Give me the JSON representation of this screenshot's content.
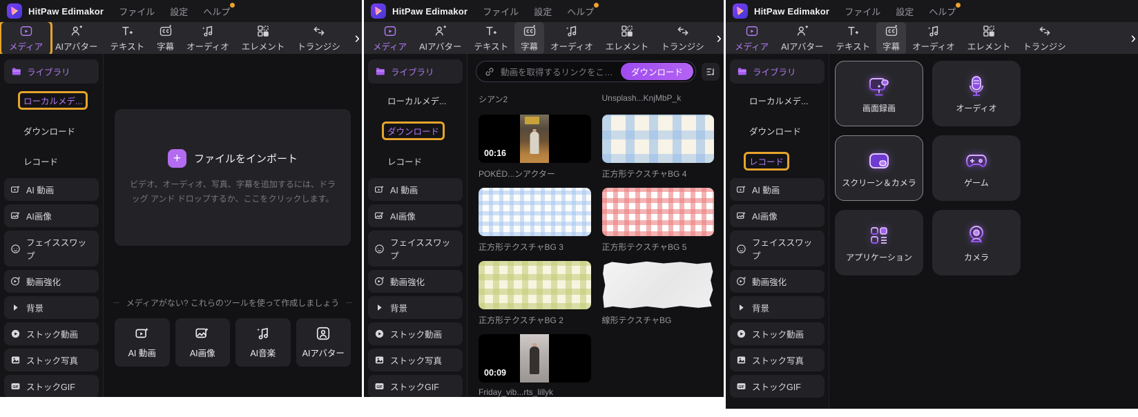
{
  "colors": {
    "accent": "#a95ef2",
    "tab_active": "#b279f2",
    "highlight_box": "#e7a52b",
    "download_button_bg": "#a855f0"
  },
  "app": {
    "title": "HitPaw Edimakor",
    "menu": [
      {
        "label": "ファイル"
      },
      {
        "label": "設定"
      },
      {
        "label": "ヘルプ"
      }
    ],
    "tabs": [
      {
        "label": "メディア",
        "icon": "media-icon"
      },
      {
        "label": "AIアバター",
        "icon": "ai-avatar-icon"
      },
      {
        "label": "テキスト",
        "icon": "text-icon"
      },
      {
        "label": "字幕",
        "icon": "subtitle-icon"
      },
      {
        "label": "オーディオ",
        "icon": "audio-icon"
      },
      {
        "label": "エレメント",
        "icon": "elements-icon"
      },
      {
        "label": "トランジシ",
        "icon": "transition-icon"
      }
    ],
    "more_chevron": "›"
  },
  "sidebar": {
    "library": {
      "label": "ライブラリ",
      "icon": "folder-icon"
    },
    "children": [
      {
        "label": "ローカルメデ..."
      },
      {
        "label": "ダウンロード"
      },
      {
        "label": "レコード"
      }
    ],
    "tools": [
      {
        "label": "AI 動画",
        "icon": "ai-video-icon"
      },
      {
        "label": "AI画像",
        "icon": "ai-image-icon"
      },
      {
        "label": "フェイススワップ",
        "icon": "face-swap-icon"
      },
      {
        "label": "動画強化",
        "icon": "video-enhance-icon"
      },
      {
        "label": "背景",
        "icon": "caret-right-icon"
      },
      {
        "label": "ストック動画",
        "icon": "stock-video-icon"
      },
      {
        "label": "ストック写真",
        "icon": "stock-photo-icon"
      },
      {
        "label": "ストックGIF",
        "icon": "stock-gif-icon"
      }
    ]
  },
  "import_panel": {
    "title": "ファイルをインポート",
    "description": "ビデオ、オーディオ、写真、字幕を追加するには、ドラッグ アンド ドロップするか、ここをクリックします。",
    "no_media_hint": "メディアがない? これらのツールを使って作成しましょう",
    "tool_cards": [
      {
        "label": "AI 動画",
        "icon": "ai-video-icon"
      },
      {
        "label": "AI画像",
        "icon": "ai-image-icon"
      },
      {
        "label": "AI音楽",
        "icon": "ai-music-icon"
      },
      {
        "label": "AIアバター",
        "icon": "ai-avatar-icon"
      }
    ]
  },
  "downloads_panel": {
    "url_placeholder": "動画を取得するリンクをここ...",
    "download_button": "ダウンロード",
    "partial_labels": [
      {
        "label": "シアン2"
      },
      {
        "label": "Unsplash...KnjMbP_k"
      }
    ],
    "items": [
      {
        "kind": "video",
        "duration": "00:16",
        "label": "POKÉD...ンアクター"
      },
      {
        "kind": "texture",
        "label": "正方形テクスチャBG 4"
      },
      {
        "kind": "texture",
        "label": "正方形テクスチャBG 3"
      },
      {
        "kind": "texture",
        "label": "正方形テクスチャBG 5"
      },
      {
        "kind": "texture",
        "label": "正方形テクスチャBG 2"
      },
      {
        "kind": "texture",
        "label": "線形テクスチャBG"
      },
      {
        "kind": "video",
        "duration": "00:09",
        "label": "Friday_vib...rts_lillyk"
      }
    ]
  },
  "record_panel": {
    "options": [
      {
        "label": "画面録画",
        "icon": "screen-record-icon"
      },
      {
        "label": "オーディオ",
        "icon": "audio-record-icon"
      },
      {
        "label": "スクリーン＆カメラ",
        "icon": "screen-camera-icon"
      },
      {
        "label": "ゲーム",
        "icon": "game-icon"
      },
      {
        "label": "アプリケーション",
        "icon": "application-icon"
      },
      {
        "label": "カメラ",
        "icon": "camera-icon"
      }
    ]
  }
}
